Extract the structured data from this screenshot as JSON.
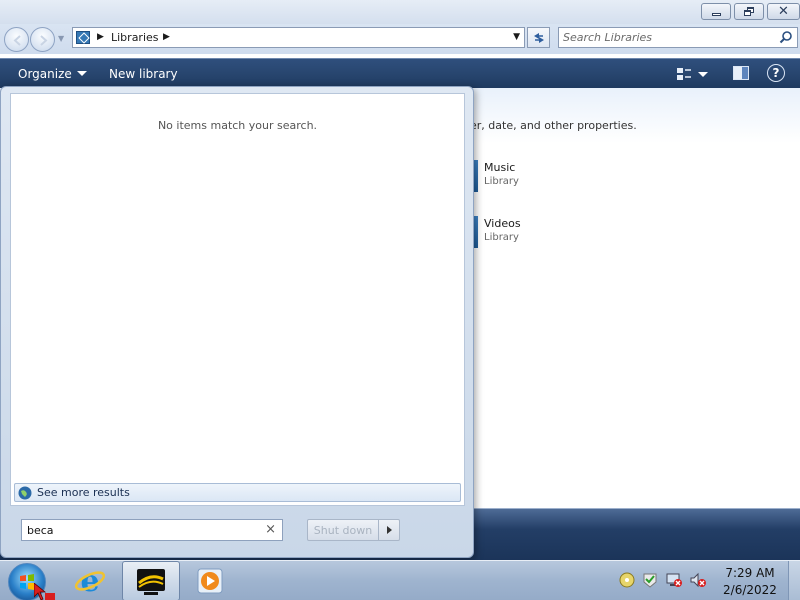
{
  "window": {
    "address": {
      "crumbs": [
        "Libraries"
      ]
    },
    "search": {
      "placeholder": "Search Libraries"
    },
    "toolbar": {
      "organize": "Organize",
      "new_library": "New library"
    },
    "content": {
      "subtitle_fragment": "er, date, and other properties.",
      "items": [
        {
          "name": "Music",
          "type": "Library"
        },
        {
          "name": "Videos",
          "type": "Library"
        }
      ]
    }
  },
  "start_menu": {
    "no_results": "No items match your search.",
    "see_more": "See more results",
    "search_value": "beca",
    "shutdown_label": "Shut down"
  },
  "taskbar": {
    "clock_time": "7:29 AM",
    "clock_date": "2/6/2022"
  },
  "icons": [
    "minimize-icon",
    "maximize-icon",
    "close-icon",
    "back-arrow-icon",
    "forward-arrow-icon",
    "library-icon",
    "refresh-icon",
    "search-icon",
    "views-icon",
    "preview-pane-icon",
    "help-icon",
    "globe-icon",
    "clear-icon",
    "windows-logo-icon",
    "internet-explorer-icon",
    "media-player-icon",
    "action-center-icon",
    "network-icon",
    "volume-muted-icon"
  ],
  "colors": {
    "toolbar": "#28466f",
    "accent": "#2a7fc8"
  }
}
